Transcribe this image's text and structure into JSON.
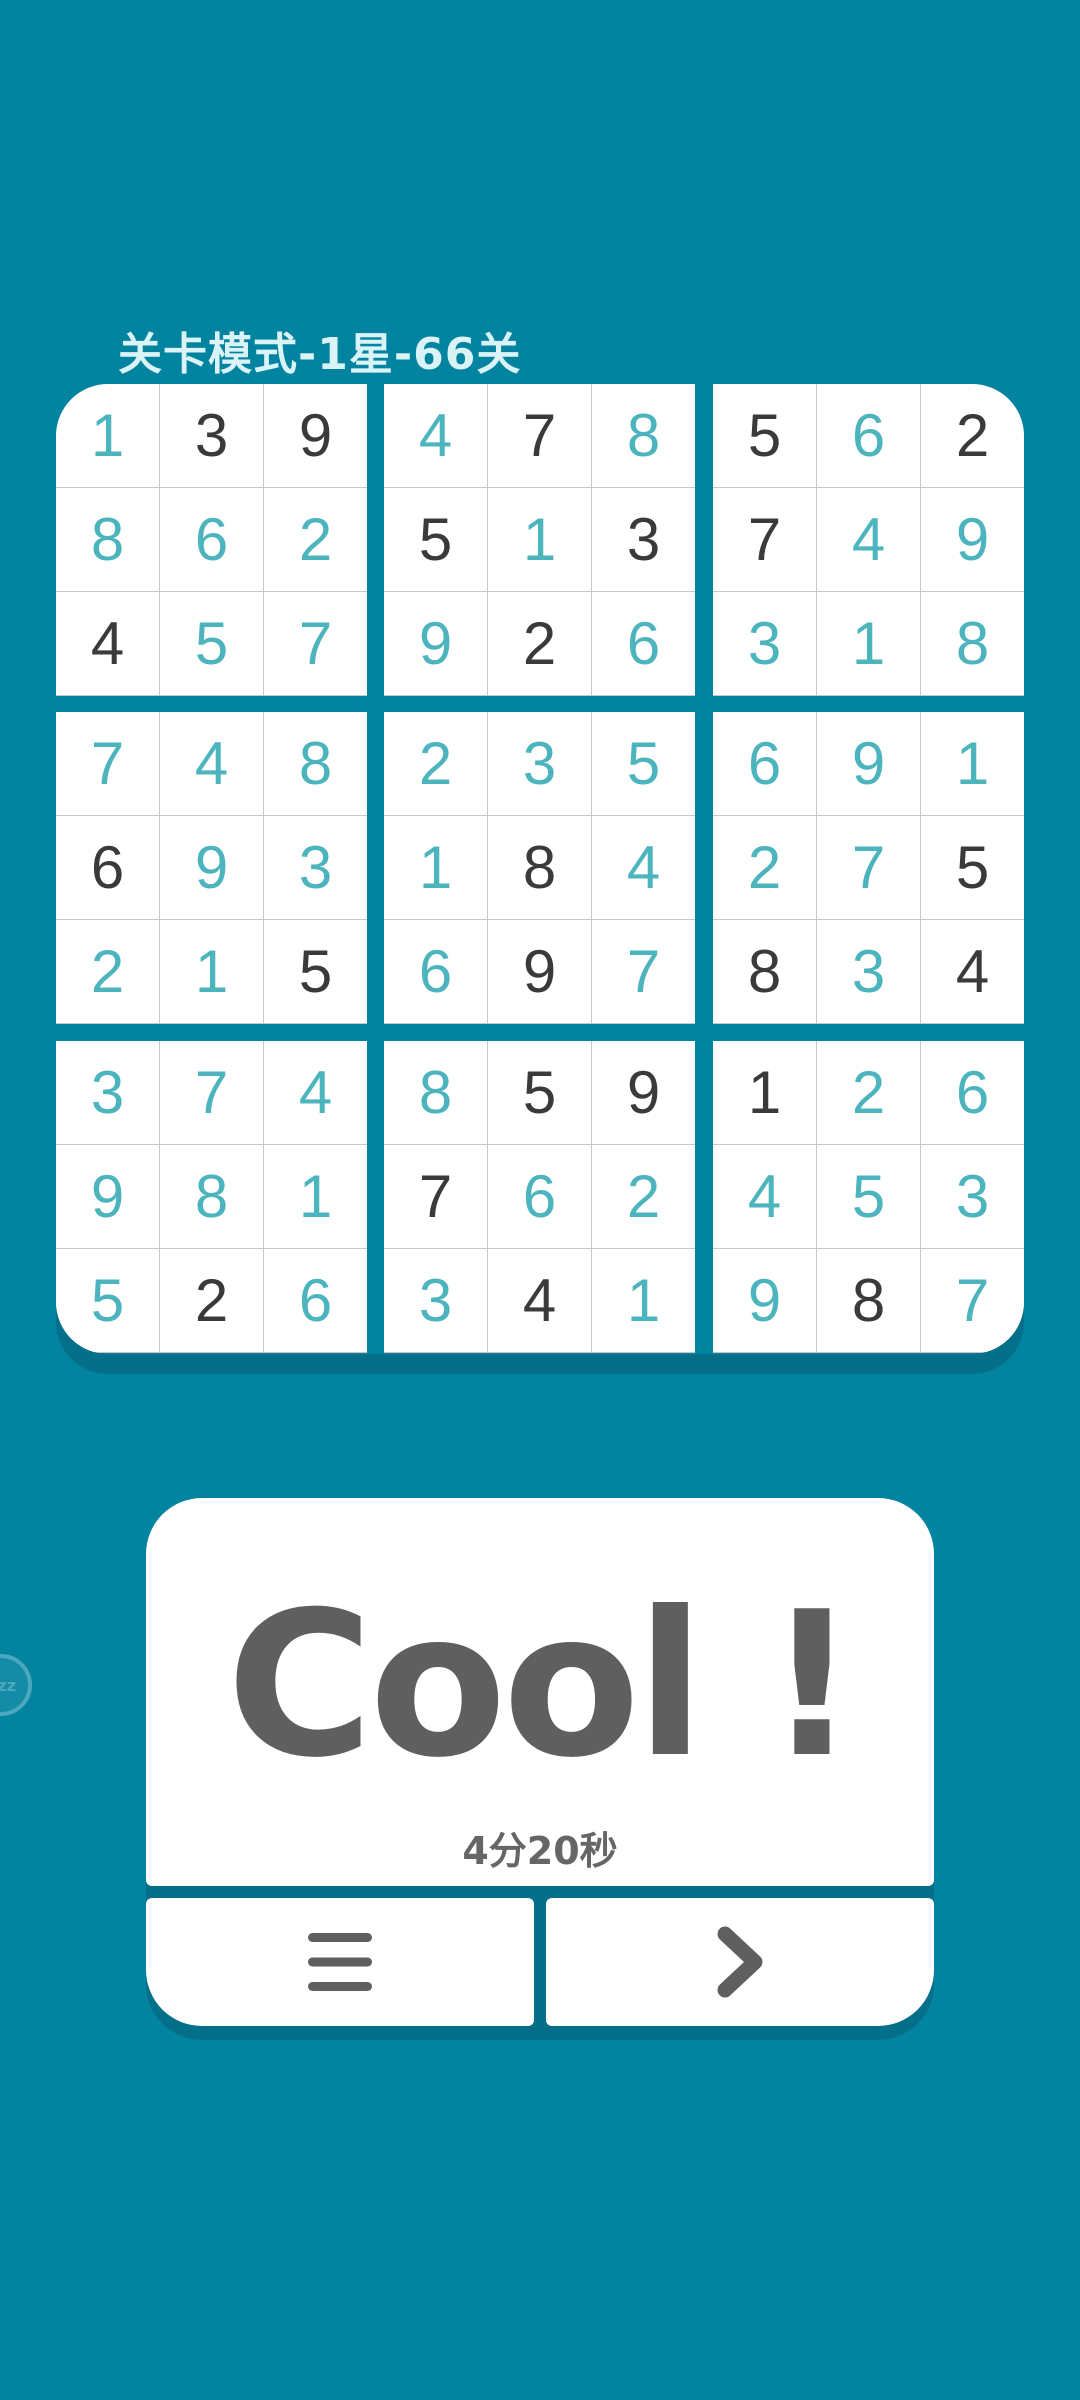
{
  "header": {
    "level_title": "关卡模式-1星-66关"
  },
  "board": {
    "boxes": [
      {
        "cells": [
          {
            "v": "1",
            "user": true
          },
          {
            "v": "3",
            "user": false
          },
          {
            "v": "9",
            "user": false
          },
          {
            "v": "8",
            "user": true
          },
          {
            "v": "6",
            "user": true
          },
          {
            "v": "2",
            "user": true
          },
          {
            "v": "4",
            "user": false
          },
          {
            "v": "5",
            "user": true
          },
          {
            "v": "7",
            "user": true
          }
        ]
      },
      {
        "cells": [
          {
            "v": "4",
            "user": true
          },
          {
            "v": "7",
            "user": false
          },
          {
            "v": "8",
            "user": true
          },
          {
            "v": "5",
            "user": false
          },
          {
            "v": "1",
            "user": true
          },
          {
            "v": "3",
            "user": false
          },
          {
            "v": "9",
            "user": true
          },
          {
            "v": "2",
            "user": false
          },
          {
            "v": "6",
            "user": true
          }
        ]
      },
      {
        "cells": [
          {
            "v": "5",
            "user": false
          },
          {
            "v": "6",
            "user": true
          },
          {
            "v": "2",
            "user": false
          },
          {
            "v": "7",
            "user": false
          },
          {
            "v": "4",
            "user": true
          },
          {
            "v": "9",
            "user": true
          },
          {
            "v": "3",
            "user": true
          },
          {
            "v": "1",
            "user": true
          },
          {
            "v": "8",
            "user": true
          }
        ]
      },
      {
        "cells": [
          {
            "v": "7",
            "user": true
          },
          {
            "v": "4",
            "user": true
          },
          {
            "v": "8",
            "user": true
          },
          {
            "v": "6",
            "user": false
          },
          {
            "v": "9",
            "user": true
          },
          {
            "v": "3",
            "user": true
          },
          {
            "v": "2",
            "user": true
          },
          {
            "v": "1",
            "user": true
          },
          {
            "v": "5",
            "user": false
          }
        ]
      },
      {
        "cells": [
          {
            "v": "2",
            "user": true
          },
          {
            "v": "3",
            "user": true
          },
          {
            "v": "5",
            "user": true
          },
          {
            "v": "1",
            "user": true
          },
          {
            "v": "8",
            "user": false
          },
          {
            "v": "4",
            "user": true
          },
          {
            "v": "6",
            "user": true
          },
          {
            "v": "9",
            "user": false
          },
          {
            "v": "7",
            "user": true
          }
        ]
      },
      {
        "cells": [
          {
            "v": "6",
            "user": true
          },
          {
            "v": "9",
            "user": true
          },
          {
            "v": "1",
            "user": true
          },
          {
            "v": "2",
            "user": true
          },
          {
            "v": "7",
            "user": true
          },
          {
            "v": "5",
            "user": false
          },
          {
            "v": "8",
            "user": false
          },
          {
            "v": "3",
            "user": true
          },
          {
            "v": "4",
            "user": false
          }
        ]
      },
      {
        "cells": [
          {
            "v": "3",
            "user": true
          },
          {
            "v": "7",
            "user": true
          },
          {
            "v": "4",
            "user": true
          },
          {
            "v": "9",
            "user": true
          },
          {
            "v": "8",
            "user": true
          },
          {
            "v": "1",
            "user": true
          },
          {
            "v": "5",
            "user": true
          },
          {
            "v": "2",
            "user": false
          },
          {
            "v": "6",
            "user": true
          }
        ]
      },
      {
        "cells": [
          {
            "v": "8",
            "user": true
          },
          {
            "v": "5",
            "user": false
          },
          {
            "v": "9",
            "user": false
          },
          {
            "v": "7",
            "user": false
          },
          {
            "v": "6",
            "user": true
          },
          {
            "v": "2",
            "user": true
          },
          {
            "v": "3",
            "user": true
          },
          {
            "v": "4",
            "user": false
          },
          {
            "v": "1",
            "user": true
          }
        ]
      },
      {
        "cells": [
          {
            "v": "1",
            "user": false
          },
          {
            "v": "2",
            "user": true
          },
          {
            "v": "6",
            "user": true
          },
          {
            "v": "4",
            "user": true
          },
          {
            "v": "5",
            "user": true
          },
          {
            "v": "3",
            "user": true
          },
          {
            "v": "9",
            "user": true
          },
          {
            "v": "8",
            "user": false
          },
          {
            "v": "7",
            "user": true
          }
        ]
      }
    ]
  },
  "result": {
    "headline": "Cool !",
    "time": "4分20秒"
  },
  "buttons": {
    "menu_icon": "menu-icon",
    "next_icon": "chevron-right-icon"
  },
  "colors": {
    "background": "#0283a0",
    "given_digit": "#3a3a3a",
    "filled_digit": "#4cb4bd",
    "headline": "#5f5f5f"
  }
}
